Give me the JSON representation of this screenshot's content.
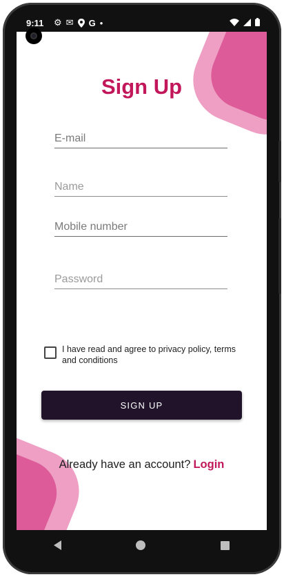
{
  "status_bar": {
    "time": "9:11",
    "left_icons": [
      "settings-icon",
      "gmail-icon",
      "location-icon",
      "google-icon",
      "dot-icon"
    ],
    "right_icons": [
      "wifi-icon",
      "signal-icon",
      "battery-icon"
    ]
  },
  "page": {
    "title": "Sign Up"
  },
  "form": {
    "email_placeholder": "E-mail",
    "name_placeholder": "Name",
    "mobile_placeholder": "Mobile number",
    "password_placeholder": "Password",
    "checkbox_checked": false,
    "agreement_label": "I have read and agree to privacy policy, terms and conditions",
    "signup_button": "SIGN UP"
  },
  "footer": {
    "prompt": "Already have an account?",
    "login_link": "Login"
  },
  "colors": {
    "accent": "#c2185b",
    "button_bg": "#20132a",
    "blob_light": "#ee9fc3",
    "blob_dark": "#dc5b98"
  }
}
